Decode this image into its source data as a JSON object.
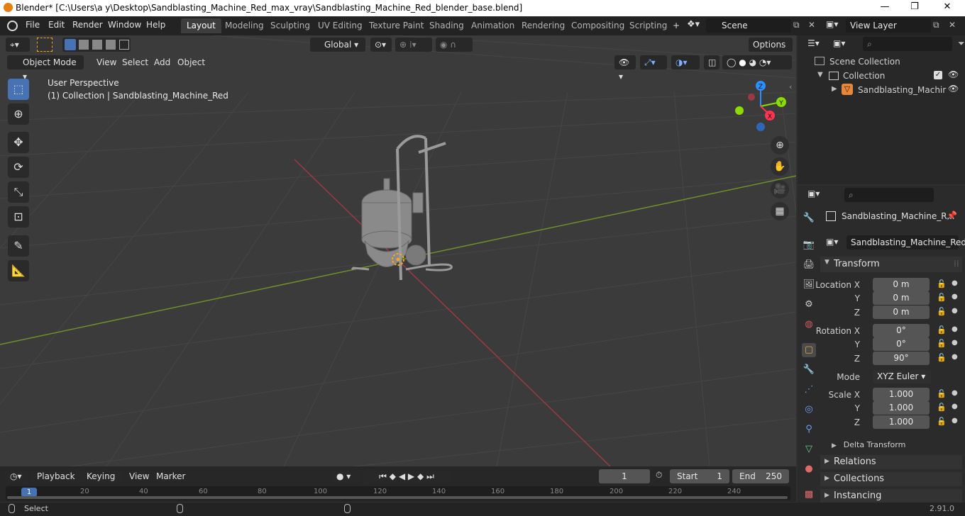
{
  "title_bar": {
    "title": "Blender* [C:\\Users\\a y\\Desktop\\Sandblasting_Machine_Red_max_vray\\Sandblasting_Machine_Red_blender_base.blend]",
    "minimize": "—",
    "maximize": "❐",
    "close": "✕"
  },
  "menu": {
    "file": "File",
    "edit": "Edit",
    "render": "Render",
    "window": "Window",
    "help": "Help"
  },
  "workspaces": [
    "Layout",
    "Modeling",
    "Sculpting",
    "UV Editing",
    "Texture Paint",
    "Shading",
    "Animation",
    "Rendering",
    "Compositing",
    "Scripting"
  ],
  "add_workspace": "+",
  "scene": {
    "value": "Scene"
  },
  "view_layer": {
    "value": "View Layer"
  },
  "viewport_toolbar": {
    "transform_orientation": "Global",
    "options": "Options"
  },
  "viewport_header": {
    "mode": "Object Mode",
    "view": "View",
    "select": "Select",
    "add": "Add",
    "object": "Object"
  },
  "viewport_info": {
    "perspective": "User Perspective",
    "collection": "(1) Collection | Sandblasting_Machine_Red"
  },
  "gizmo": {
    "x": "X",
    "y": "Y",
    "z": "Z"
  },
  "outliner": {
    "scene_collection": "Scene Collection",
    "collection": "Collection",
    "object": "Sandblasting_Machir"
  },
  "properties": {
    "object_name_header": "Sandblasting_Machine_R...",
    "object_name": "Sandblasting_Machine_Red",
    "transform_title": "Transform",
    "location_x_label": "Location X",
    "location_x": "0 m",
    "location_y_label": "Y",
    "location_y": "0 m",
    "location_z_label": "Z",
    "location_z": "0 m",
    "rotation_x_label": "Rotation X",
    "rotation_x": "0°",
    "rotation_y_label": "Y",
    "rotation_y": "0°",
    "rotation_z_label": "Z",
    "rotation_z": "90°",
    "mode_label": "Mode",
    "mode_value": "XYZ Euler",
    "scale_x_label": "Scale X",
    "scale_x": "1.000",
    "scale_y_label": "Y",
    "scale_y": "1.000",
    "scale_z_label": "Z",
    "scale_z": "1.000",
    "delta_transform": "Delta Transform",
    "relations": "Relations",
    "collections": "Collections",
    "instancing": "Instancing"
  },
  "timeline": {
    "playback": "Playback",
    "keying": "Keying",
    "view": "View",
    "marker": "Marker",
    "current_frame": "1",
    "start_label": "Start",
    "start": "1",
    "end_label": "End",
    "end": "250",
    "ruler": [
      "1",
      "20",
      "40",
      "60",
      "80",
      "100",
      "120",
      "140",
      "160",
      "180",
      "200",
      "220",
      "240"
    ]
  },
  "status": {
    "select": "Select",
    "version": "2.91.0"
  },
  "colors": {
    "accent": "#4772b3",
    "x_axis": "#ff3352",
    "y_axis": "#8bdc00",
    "z_axis": "#2890ff",
    "selection": "#f5a623"
  }
}
